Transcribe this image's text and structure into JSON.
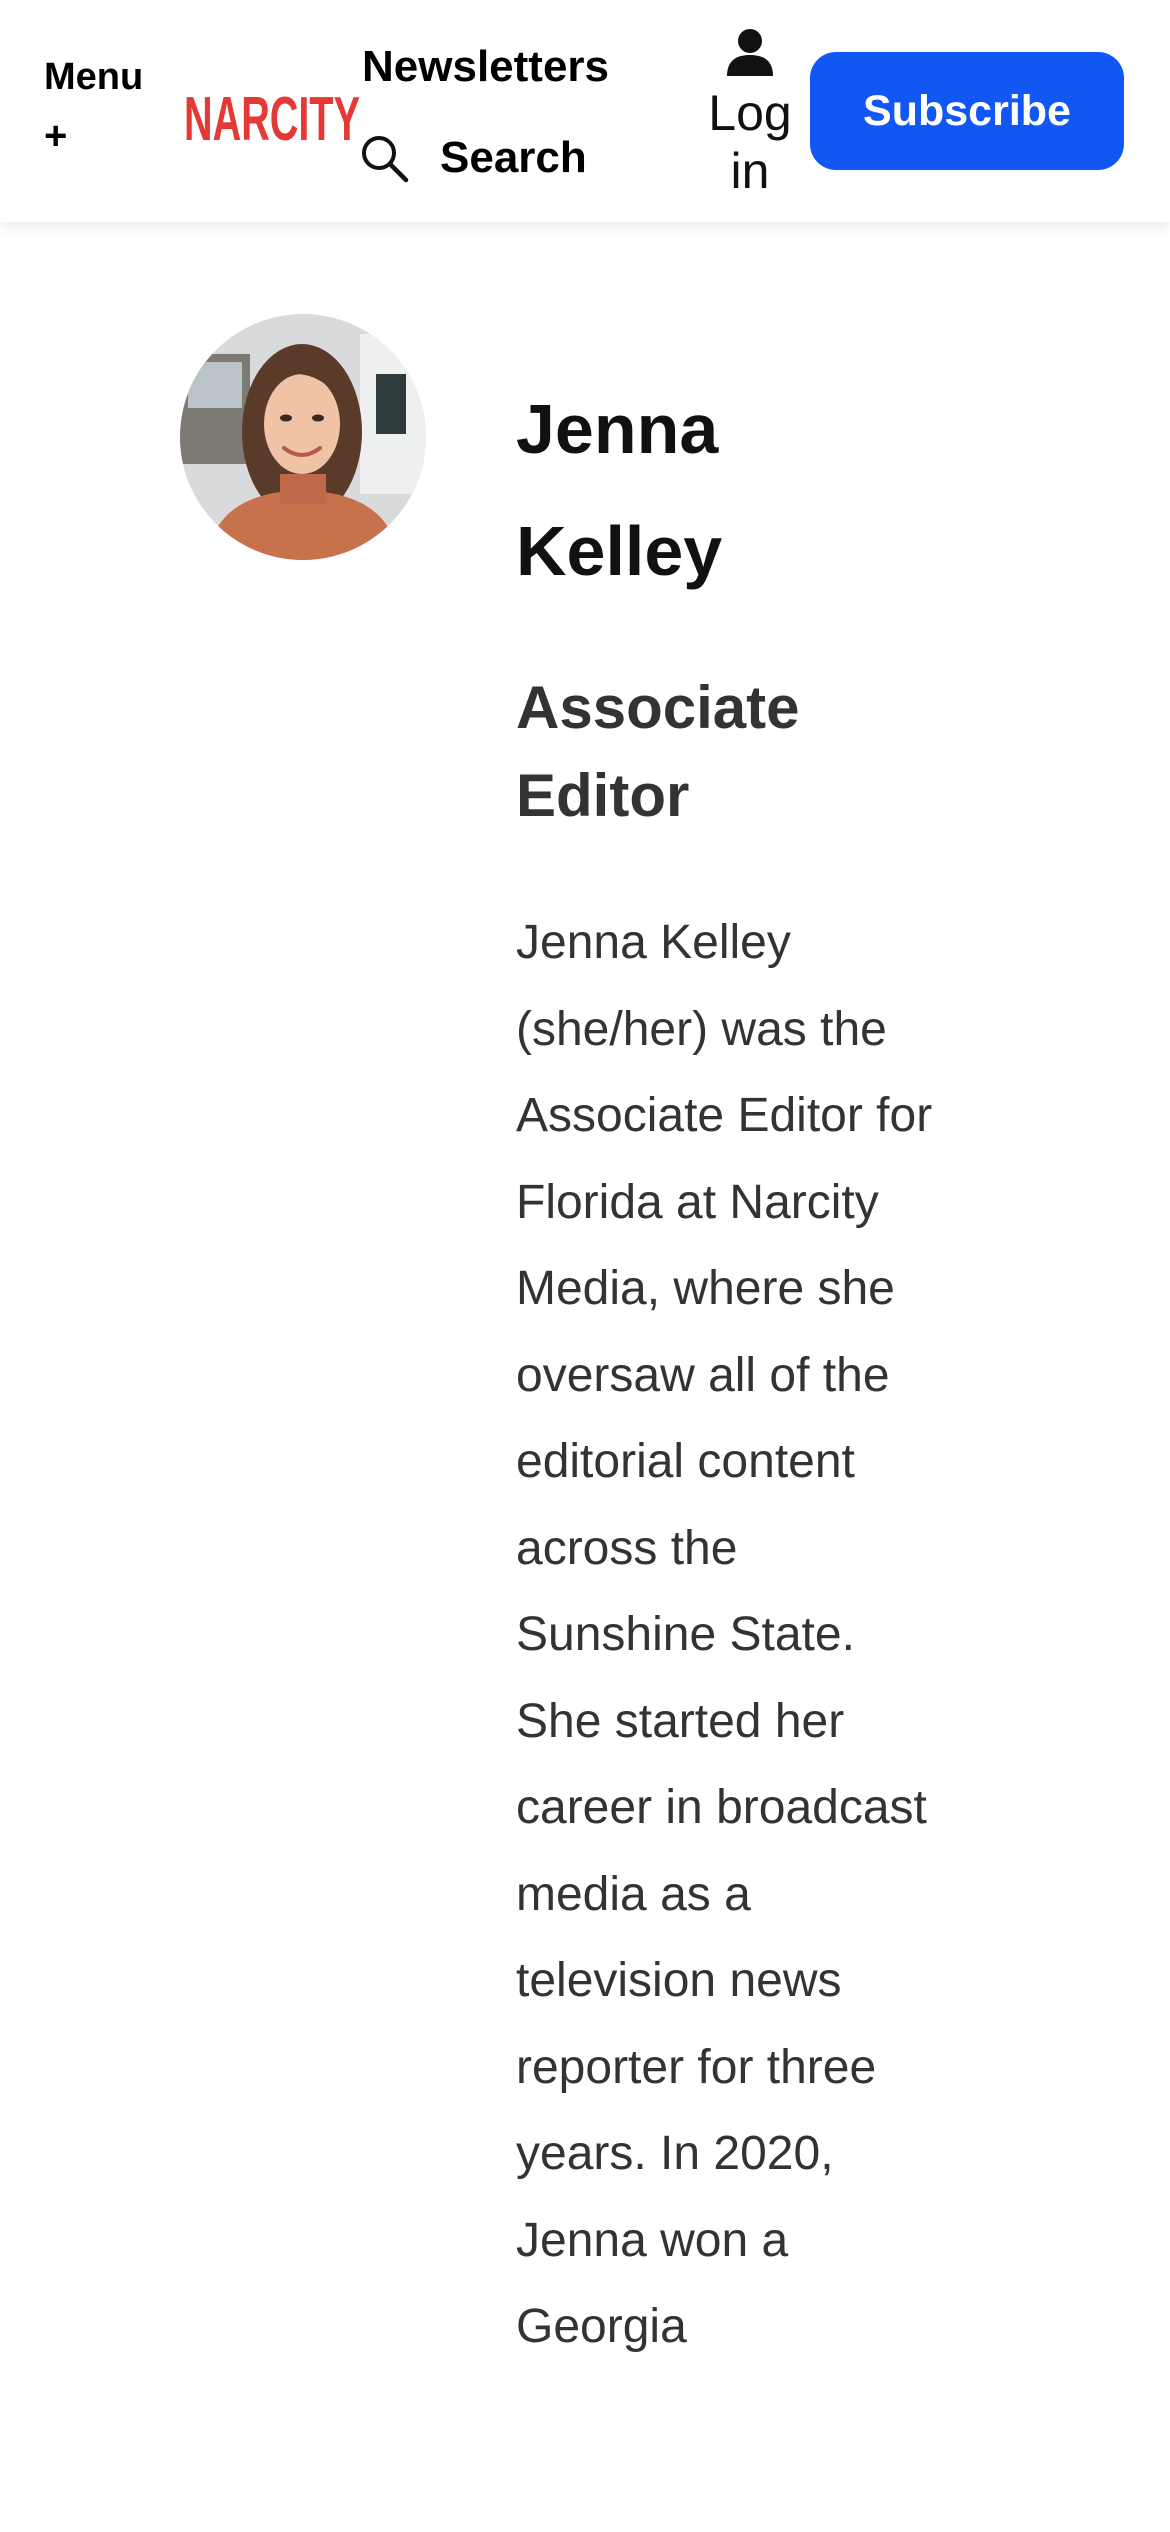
{
  "header": {
    "menu_label": "Menu",
    "menu_plus": "+",
    "logo_text": "NARCITY",
    "newsletters_label": "Newsletters",
    "search_label": "Search",
    "login_label": "Log in",
    "subscribe_label": "Subscribe"
  },
  "author": {
    "name": "Jenna Kelley",
    "title": "Associate Editor",
    "bio": "Jenna Kelley (she/her) was the Associate Editor for Florida at Narcity Media, where she oversaw all of the editorial content across the Sunshine State. She started her career in broadcast media as a television news reporter for three years. In 2020, Jenna won a Georgia"
  },
  "colors": {
    "accent": "#1157f4",
    "logo_red": "#e53935",
    "heading": "#111111",
    "body_text": "#333333"
  },
  "icons": {
    "search": "search-icon",
    "user": "user-icon",
    "menu_plus": "plus-icon"
  }
}
